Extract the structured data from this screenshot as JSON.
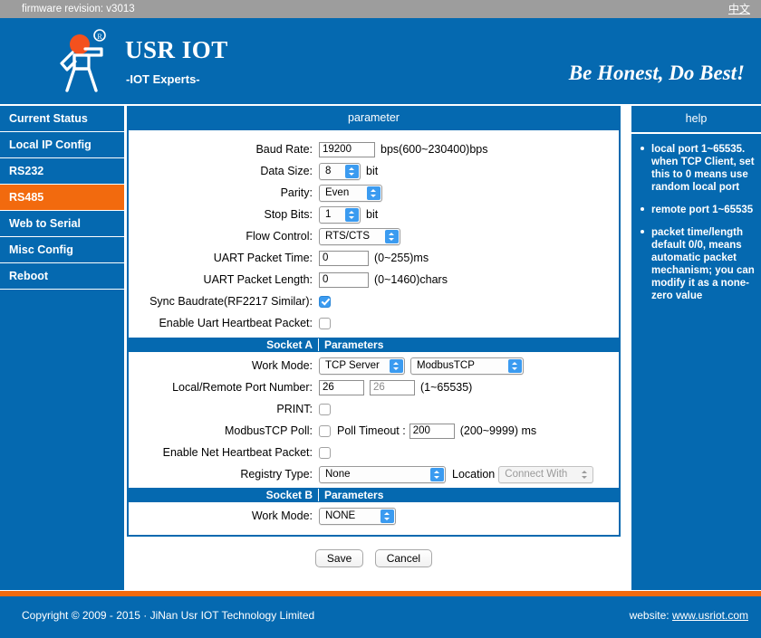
{
  "topbar": {
    "firmware_label": "firmware revision: v3013",
    "language_link": "中文"
  },
  "header": {
    "brand": "USR IOT",
    "brand_sub": "-IOT Experts-",
    "tagline": "Be Honest, Do Best!",
    "logo_icon": "running-man-logo",
    "background_color": "#0569b0"
  },
  "sidebar": {
    "items": [
      {
        "label": "Current Status",
        "active": false
      },
      {
        "label": "Local IP Config",
        "active": false
      },
      {
        "label": "RS232",
        "active": false
      },
      {
        "label": "RS485",
        "active": true
      },
      {
        "label": "Web to Serial",
        "active": false
      },
      {
        "label": "Misc Config",
        "active": false
      },
      {
        "label": "Reboot",
        "active": false
      }
    ],
    "active_color": "#f26a0e"
  },
  "main": {
    "panel_title": "parameter",
    "rows": {
      "baud_rate": {
        "label": "Baud Rate:",
        "value": "19200",
        "hint": "bps(600~230400)bps"
      },
      "data_size": {
        "label": "Data Size:",
        "value": "8",
        "hint": "bit"
      },
      "parity": {
        "label": "Parity:",
        "value": "Even"
      },
      "stop_bits": {
        "label": "Stop Bits:",
        "value": "1",
        "hint": "bit"
      },
      "flow_control": {
        "label": "Flow Control:",
        "value": "RTS/CTS"
      },
      "uart_packet_time": {
        "label": "UART Packet Time:",
        "value": "0",
        "hint": "(0~255)ms"
      },
      "uart_packet_length": {
        "label": "UART Packet Length:",
        "value": "0",
        "hint": "(0~1460)chars"
      },
      "sync_baudrate": {
        "label": "Sync Baudrate(RF2217 Similar):",
        "checked": true
      },
      "enable_uart_heartbeat": {
        "label": "Enable Uart Heartbeat Packet:",
        "checked": false
      }
    },
    "socket_a": {
      "section_left": "Socket A",
      "section_right": "Parameters",
      "work_mode": {
        "label": "Work Mode:",
        "value": "TCP Server",
        "protocol_value": "ModbusTCP"
      },
      "port_number": {
        "label": "Local/Remote Port Number:",
        "local_value": "26",
        "remote_value": "26",
        "hint": "(1~65535)"
      },
      "print": {
        "label": "PRINT:",
        "checked": false
      },
      "modbustcp_poll": {
        "label": "ModbusTCP Poll:",
        "checked": false,
        "timeout_label": "Poll Timeout :",
        "timeout_value": "200",
        "timeout_hint": "(200~9999) ms"
      },
      "enable_net_heartbeat": {
        "label": "Enable Net Heartbeat Packet:",
        "checked": false
      },
      "registry_type": {
        "label": "Registry Type:",
        "value": "None",
        "location_label": "Location",
        "location_value": "Connect With"
      }
    },
    "socket_b": {
      "section_left": "Socket B",
      "section_right": "Parameters",
      "work_mode": {
        "label": "Work Mode:",
        "value": "NONE"
      }
    },
    "buttons": {
      "save": "Save",
      "cancel": "Cancel"
    }
  },
  "help": {
    "title": "help",
    "items": [
      {
        "term": "local port",
        "desc": "1~65535. when TCP Client, set this to 0 means use random local port"
      },
      {
        "term": "remote port",
        "desc": "1~65535"
      },
      {
        "term": "packet time/length",
        "desc": "default 0/0, means automatic packet mechanism; you can modify it as a none-zero value"
      }
    ]
  },
  "footer": {
    "copyright": "Copyright © 2009 - 2015 · JiNan Usr IOT Technology Limited",
    "website_label": "website:",
    "website_url": "www.usriot.com"
  }
}
